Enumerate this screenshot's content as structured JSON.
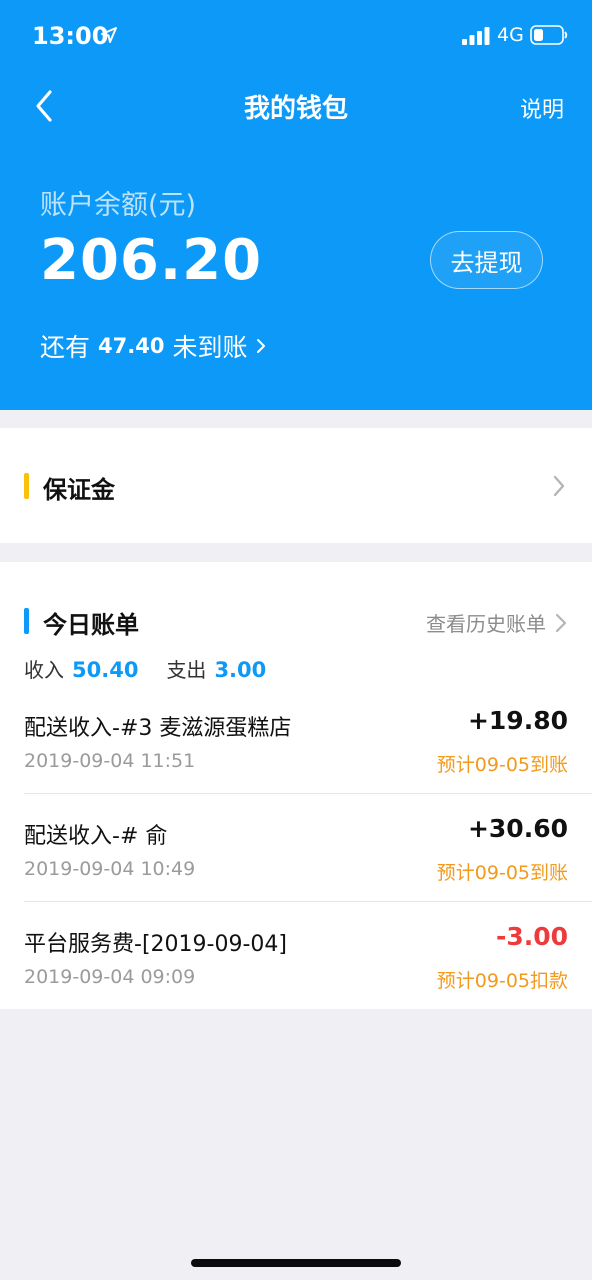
{
  "status_bar": {
    "time": "13:00",
    "network": "4G"
  },
  "nav": {
    "title": "我的钱包",
    "action_label": "说明"
  },
  "balance": {
    "label": "账户余额(元)",
    "value": "206.20",
    "withdraw_label": "去提现",
    "pending_prefix": "还有",
    "pending_amount": "47.40",
    "pending_suffix": "未到账"
  },
  "deposit": {
    "title": "保证金"
  },
  "bills": {
    "title": "今日账单",
    "history_label": "查看历史账单",
    "income_label": "收入",
    "income_value": "50.40",
    "expense_label": "支出",
    "expense_value": "3.00",
    "items": [
      {
        "desc": "配送收入-#3 麦滋源蛋糕店",
        "amount": "+19.80",
        "date": "2019-09-04 11:51",
        "note": "预计09-05到账"
      },
      {
        "desc": "配送收入-# 俞",
        "amount": "+30.60",
        "date": "2019-09-04 10:49",
        "note": "预计09-05到账"
      },
      {
        "desc": "平台服务费-[2019-09-04]",
        "amount": "-3.00",
        "date": "2019-09-04 09:09",
        "note": "预计09-05扣款"
      }
    ]
  },
  "colors": {
    "brand_blue": "#0d99f7",
    "deposit_accent": "#f9c10a",
    "note_orange": "#f39a1d",
    "negative_red": "#ee3a3a"
  }
}
